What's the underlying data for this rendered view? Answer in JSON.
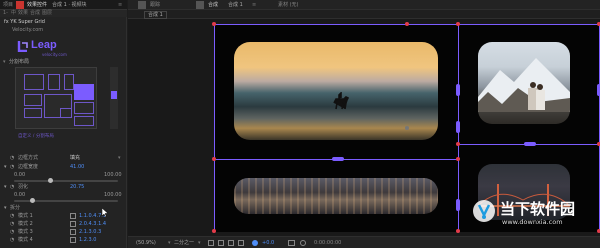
{
  "left_panel": {
    "tab1": "项目",
    "tab2": "效果控件",
    "tab2_value": "合成 1 · 视频块",
    "menu": [
      "1-",
      "中",
      "效果",
      "合成",
      "图层"
    ],
    "layer_row": "fx  YK Super Grid",
    "layer_row_sub": "Velocity.com",
    "logo_text": "Leap",
    "logo_sub": "velocity.com",
    "section": "分割布局",
    "grid_caption": "自定义  / 分割布局",
    "params": [
      {
        "label": "边框方式",
        "value": "填充"
      },
      {
        "label": "边框宽度",
        "value": "41.00"
      },
      {
        "label": "",
        "value": "0.00",
        "max": "100.00"
      },
      {
        "label": "羽化",
        "value": "20.75"
      },
      {
        "label": "",
        "value": "0.00",
        "max": "100.00"
      },
      {
        "label": "拆分",
        "value": ""
      },
      {
        "label": "模式 1",
        "value": "1.1.0.4.7.1"
      },
      {
        "label": "模式 2",
        "value": "2.0.4.3.1.4"
      },
      {
        "label": "模式 3",
        "value": "2.1.3.0.3"
      },
      {
        "label": "模式 4",
        "value": "1.2.3.0"
      }
    ]
  },
  "viewer": {
    "tabs": [
      "跟踪",
      "合成",
      "合成 1",
      "素材 (无)"
    ],
    "active_label": "合成 1",
    "zoom": "(50.9%)",
    "quality": "二分之一",
    "timecode": "0:00:00:00",
    "exposure": "+0.0"
  },
  "watermark": {
    "title": "当下软件园",
    "url": "www.downxia.com"
  },
  "colors": {
    "guide": "#7b5cff",
    "pin": "#e23b4a",
    "accent": "#4f8ef7"
  }
}
